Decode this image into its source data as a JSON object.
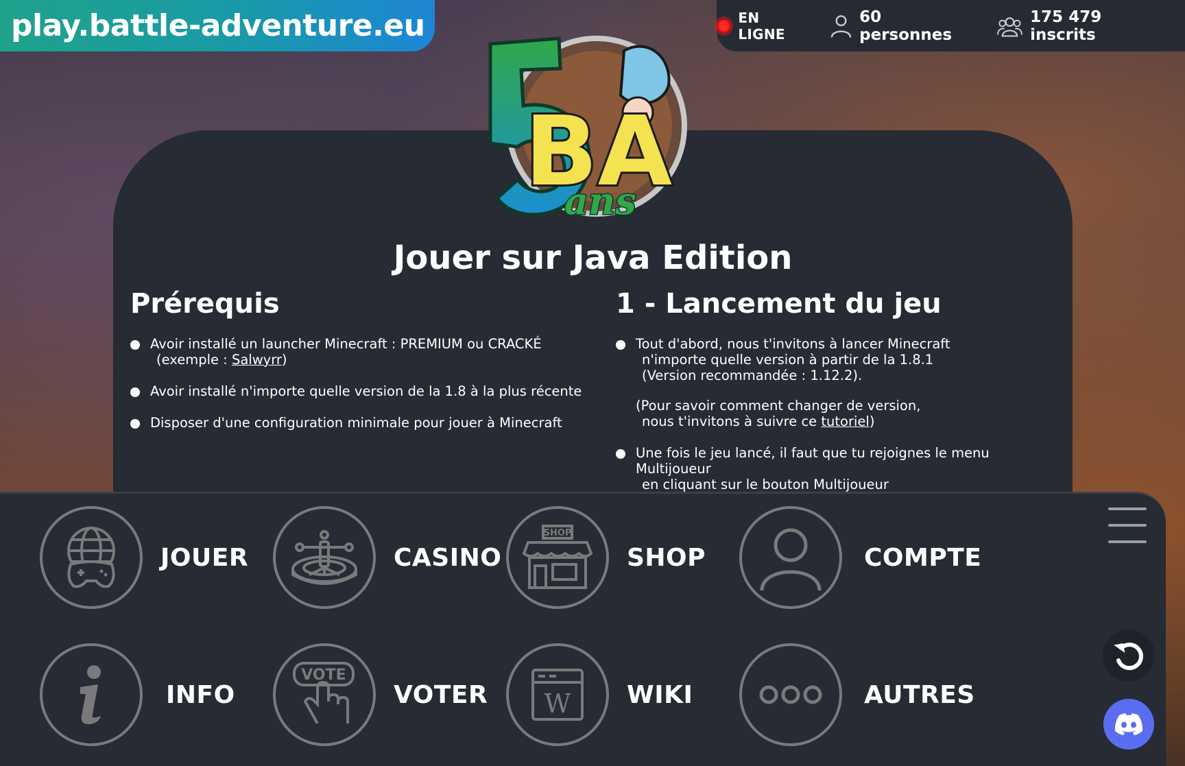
{
  "header": {
    "domain": "play.battle-adventure.eu",
    "online_label": "EN LIGNE",
    "players": "60 personnes",
    "registered": "175 479 inscrits"
  },
  "logo": {
    "big_number": "5",
    "initials": "BA",
    "subtitle": "ans"
  },
  "main": {
    "title": "Jouer sur Java Edition",
    "prereq": {
      "title": "Prérequis",
      "items": [
        {
          "line1": "Avoir installé un launcher Minecraft : PREMIUM ou CRACKÉ",
          "line2_prefix": "(exemple : ",
          "line2_link": "Salwyrr",
          "line2_suffix": ")"
        },
        {
          "line1": "Avoir installé n'importe quelle version de la 1.8 à la plus récente"
        },
        {
          "line1": "Disposer d'une configuration minimale pour jouer à Minecraft"
        }
      ]
    },
    "launch": {
      "title": "1 - Lancement du jeu",
      "items": [
        {
          "line1": "Tout d'abord, nous t'invitons à lancer Minecraft",
          "line2": "n'importe quelle version à partir de la 1.8.1",
          "line3": "(Version recommandée : 1.12.2)."
        },
        {
          "line1": "(Pour savoir comment changer de version,",
          "line2_prefix": "nous t'invitons à suivre ce ",
          "line2_link": "tutoriel",
          "line2_suffix": ")"
        },
        {
          "line1": "Une fois le jeu lancé, il faut que tu rejoignes le menu Multijoueur",
          "line2": "en cliquant sur le bouton Multijoueur"
        }
      ]
    }
  },
  "nav": {
    "items": [
      {
        "label": "JOUER",
        "icon": "globe-gamepad-icon"
      },
      {
        "label": "CASINO",
        "icon": "roulette-icon"
      },
      {
        "label": "SHOP",
        "icon": "shop-icon",
        "sign": "SHOP"
      },
      {
        "label": "COMPTE",
        "icon": "user-icon"
      },
      {
        "label": "INFO",
        "icon": "info-icon"
      },
      {
        "label": "VOTER",
        "icon": "vote-hand-icon",
        "sign": "VOTE"
      },
      {
        "label": "WIKI",
        "icon": "wiki-icon",
        "sign": "W"
      },
      {
        "label": "AUTRES",
        "icon": "more-icon"
      }
    ]
  },
  "colors": {
    "banner_start": "#1fa28a",
    "banner_end": "#1c86d6",
    "panel": "#262b34",
    "online": "#ff2a2a",
    "discord": "#5a6df0"
  }
}
